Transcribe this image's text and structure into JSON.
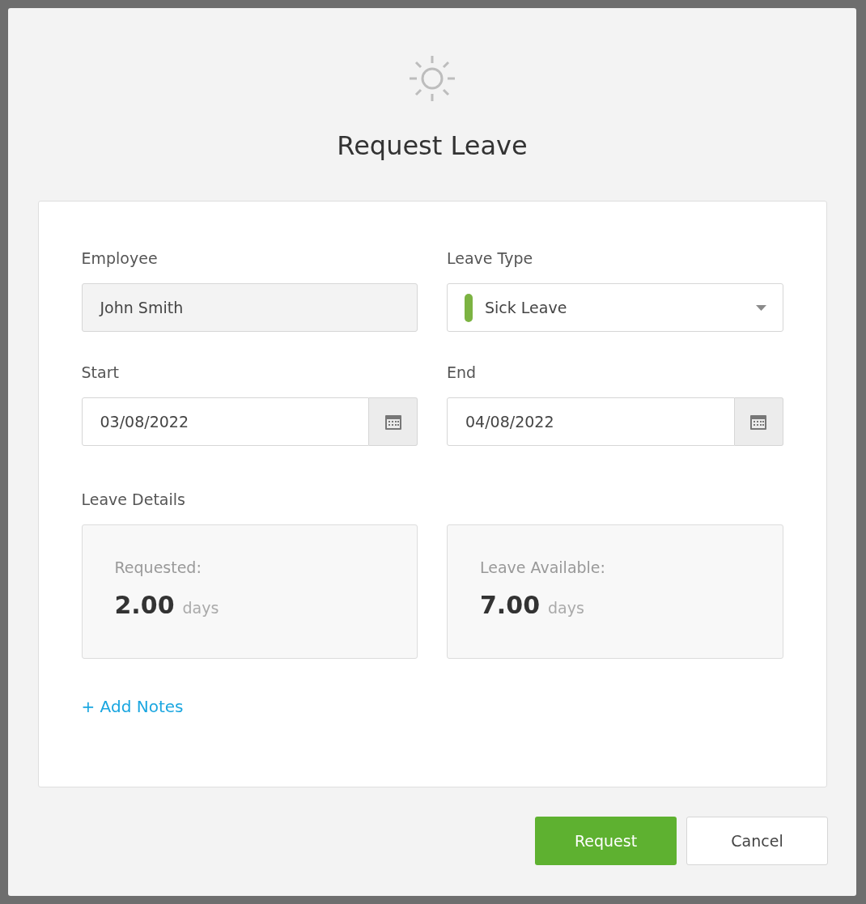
{
  "dialog": {
    "title": "Request Leave"
  },
  "form": {
    "employee": {
      "label": "Employee",
      "value": "John Smith",
      "disabled": true
    },
    "leave_type": {
      "label": "Leave Type",
      "value": "Sick Leave",
      "color": "#7cb342"
    },
    "start": {
      "label": "Start",
      "value": "03/08/2022"
    },
    "end": {
      "label": "End",
      "value": "04/08/2022"
    }
  },
  "leave_details": {
    "label": "Leave Details",
    "cards": [
      {
        "label": "Requested:",
        "value": "2.00",
        "unit": "days"
      },
      {
        "label": "Leave Available:",
        "value": "7.00",
        "unit": "days"
      }
    ]
  },
  "add_notes_link": "+ Add Notes",
  "buttons": [
    {
      "label": "Request",
      "kind": "primary"
    },
    {
      "label": "Cancel",
      "kind": "secondary"
    }
  ]
}
